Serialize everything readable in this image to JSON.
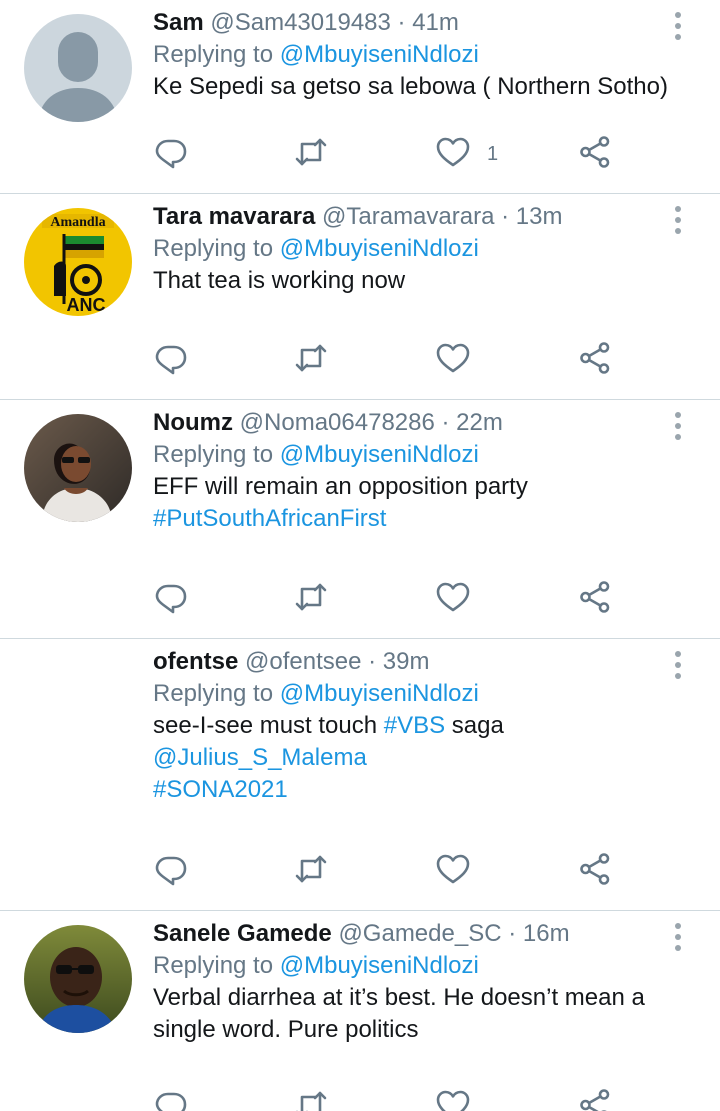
{
  "tweets": [
    {
      "name": "Sam",
      "handle": "@Sam43019483",
      "time": "· 41m",
      "replying_prefix": "Replying to",
      "replying_handle": "@MbuyiseniNdlozi",
      "text_lines": [
        [
          {
            "t": "Ke Sepedi sa getso sa lebowa ( Northern Sotho)",
            "link": false
          }
        ]
      ],
      "like_count": "1",
      "avatar": "default-avatar"
    },
    {
      "name": "Tara mavarara",
      "handle": "@Taramavarara",
      "time": "· 13m",
      "replying_prefix": "Replying to",
      "replying_handle": "@MbuyiseniNdlozi",
      "text_lines": [
        [
          {
            "t": "That tea is working now",
            "link": false
          }
        ]
      ],
      "like_count": "",
      "avatar": "anc-logo"
    },
    {
      "name": "Noumz",
      "handle": "@Noma06478286",
      "time": "· 22m",
      "replying_prefix": "Replying to",
      "replying_handle": "@MbuyiseniNdlozi",
      "text_lines": [
        [
          {
            "t": "EFF will remain an opposition party",
            "link": false
          }
        ],
        [
          {
            "t": "#PutSouthAfricanFirst",
            "link": true
          }
        ]
      ],
      "like_count": "",
      "avatar": "photo-woman"
    },
    {
      "name": "ofentse",
      "handle": "@ofentsee",
      "time": "· 39m",
      "replying_prefix": "Replying to",
      "replying_handle": "@MbuyiseniNdlozi",
      "text_lines": [
        [
          {
            "t": "see-I-see must touch ",
            "link": false
          },
          {
            "t": "#VBS",
            "link": true
          },
          {
            "t": " saga",
            "link": false
          }
        ],
        [
          {
            "t": "@Julius_S_Malema",
            "link": true
          }
        ],
        [
          {
            "t": "#SONA2021",
            "link": true
          }
        ]
      ],
      "like_count": "",
      "avatar": "none"
    },
    {
      "name": "Sanele Gamede",
      "handle": "@Gamede_SC",
      "time": "· 16m",
      "replying_prefix": "Replying to",
      "replying_handle": "@MbuyiseniNdlozi",
      "text_lines": [
        [
          {
            "t": "Verbal diarrhea at it’s best. He doesn’t mean a",
            "link": false
          }
        ],
        [
          {
            "t": "single word. Pure politics",
            "link": false
          }
        ]
      ],
      "like_count": "",
      "avatar": "photo-man"
    }
  ],
  "colors": {
    "text": "#14171a",
    "secondary": "#657786",
    "link": "#1b95e0",
    "icon": "#657786",
    "divider": "#cfd9de"
  },
  "icons": {
    "reply": "reply-icon",
    "retweet": "retweet-icon",
    "like": "like-icon",
    "share": "share-icon",
    "more": "more-vertical-icon"
  }
}
